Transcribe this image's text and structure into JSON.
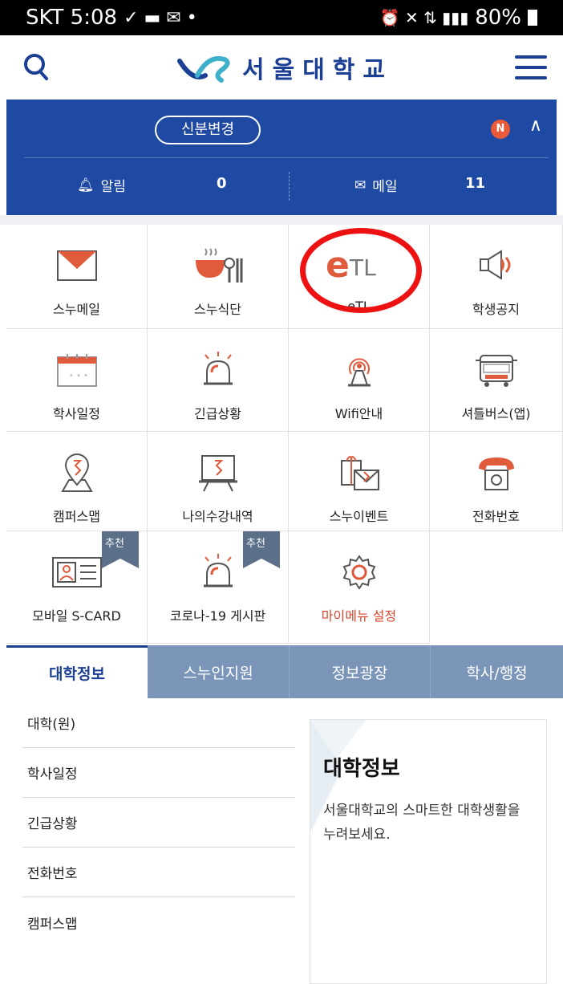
{
  "status_bar": {
    "carrier_time": "SKT 5:08",
    "battery": "80%"
  },
  "header": {
    "logo_text": "서울대학교"
  },
  "user_panel": {
    "identity_button": "신분변경",
    "new_badge": "N",
    "alerts_label": "알림",
    "alerts_count": "0",
    "mail_label": "메일",
    "mail_count": "11"
  },
  "menu_grid": [
    {
      "label": "스누메일",
      "icon": "mail-icon"
    },
    {
      "label": "스누식단",
      "icon": "meal-icon"
    },
    {
      "label": "eTL",
      "icon": "etl-logo-icon"
    },
    {
      "label": "학생공지",
      "icon": "megaphone-icon"
    },
    {
      "label": "학사일정",
      "icon": "calendar-icon"
    },
    {
      "label": "긴급상황",
      "icon": "siren-icon"
    },
    {
      "label": "Wifi안내",
      "icon": "wifi-tower-icon"
    },
    {
      "label": "셔틀버스(앱)",
      "icon": "bus-icon"
    },
    {
      "label": "캠퍼스맵",
      "icon": "map-pin-icon"
    },
    {
      "label": "나의수강내역",
      "icon": "lecture-board-icon"
    },
    {
      "label": "스누이벤트",
      "icon": "gift-mail-icon"
    },
    {
      "label": "전화번호",
      "icon": "telephone-icon"
    },
    {
      "label": "모바일 S-CARD",
      "icon": "id-card-icon",
      "ribbon": "추천"
    },
    {
      "label": "코로나-19 게시판",
      "icon": "siren-icon",
      "ribbon": "추천"
    },
    {
      "label": "마이메뉴 설정",
      "icon": "gear-icon"
    }
  ],
  "tabs": [
    "대학정보",
    "스누인지원",
    "정보광장",
    "학사/행정"
  ],
  "info_list": [
    "대학(원)",
    "학사일정",
    "긴급상황",
    "전화번호",
    "캠퍼스맵"
  ],
  "info_card": {
    "title": "대학정보",
    "description": "서울대학교의 스마트한 대학생활을 누려보세요."
  },
  "colors": {
    "primary_blue": "#1f4aa3",
    "accent_red": "#d9462b",
    "tab_gray_blue": "#7a95b8",
    "annotation_red": "#ee1111"
  }
}
